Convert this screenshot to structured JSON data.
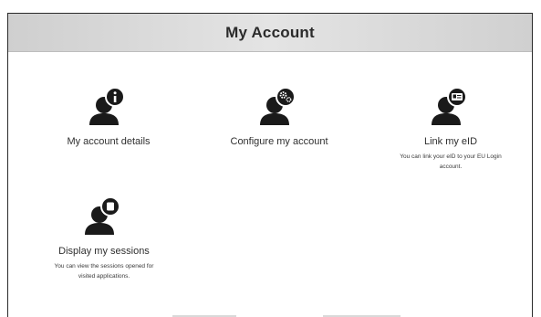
{
  "header": {
    "title": "My Account"
  },
  "tiles": [
    {
      "label": "My account details",
      "icon": "user-info-icon",
      "description": ""
    },
    {
      "label": "Configure my account",
      "icon": "user-settings-icon",
      "description": ""
    },
    {
      "label": "Link my eID",
      "icon": "user-id-card-icon",
      "description_line1": "You can link your eID to your EU Login",
      "description_line2": "account."
    },
    {
      "label": "Display my sessions",
      "icon": "user-sessions-icon",
      "description_line1": "You can view the sessions opened for",
      "description_line2": "visited applications."
    }
  ],
  "colors": {
    "icon": "#1a1a1a",
    "header_bg": "#dcdcdc",
    "text": "#2f2f2f"
  }
}
